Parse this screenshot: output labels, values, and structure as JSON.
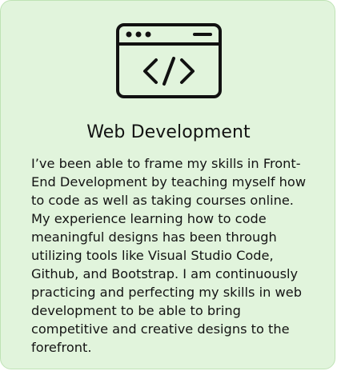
{
  "card": {
    "icon": "code-window-icon",
    "title": "Web Development",
    "description": "I’ve been able to frame my skills in Front-End Development by teaching myself how to code as well as taking courses online. My experience learning how to code meaningful designs has been through utilizing tools like Visual Studio Code, Github, and Bootstrap. I am continuously practicing and perfecting my skills in web development to be able to bring competitive and creative designs to the forefront."
  },
  "colors": {
    "card_background": "#e1f4dc",
    "card_border": "#bfe3b5",
    "text": "#141414"
  }
}
